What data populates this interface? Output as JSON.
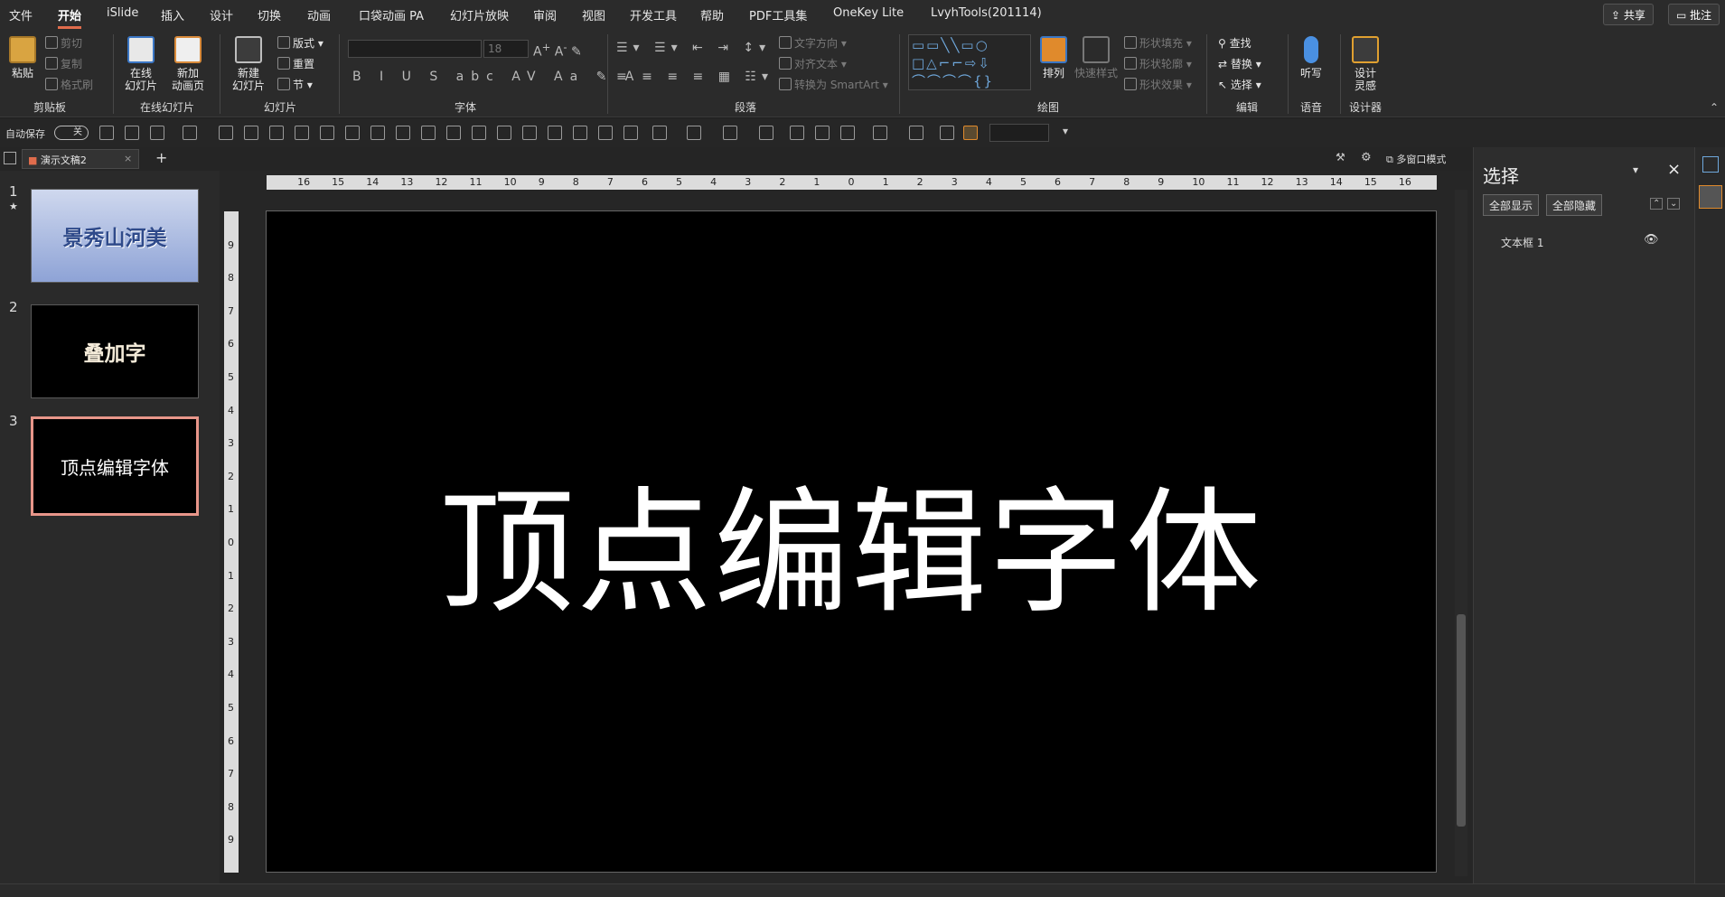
{
  "menu": {
    "items": [
      "文件",
      "开始",
      "iSlide",
      "插入",
      "设计",
      "切换",
      "动画",
      "口袋动画 PA",
      "幻灯片放映",
      "审阅",
      "视图",
      "开发工具",
      "帮助",
      "PDF工具集",
      "OneKey Lite",
      "LvyhTools(201114)"
    ],
    "active": "开始",
    "share": "共享",
    "comment": "批注"
  },
  "ribbon": {
    "clipboard": {
      "label": "剪贴板",
      "paste": "粘贴",
      "cut": "剪切",
      "copy": "复制",
      "format": "格式刷"
    },
    "online": {
      "label": "在线幻灯片",
      "online_slides": "在线\n幻灯片",
      "new_anim": "新加\n动画页"
    },
    "slides": {
      "label": "幻灯片",
      "new": "新建\n幻灯片",
      "layout": "版式",
      "reset": "重置",
      "section": "节"
    },
    "font": {
      "label": "字体",
      "size": "18"
    },
    "paragraph": {
      "label": "段落",
      "text_dir": "文字方向",
      "align_text": "对齐文本",
      "smartart": "转换为 SmartArt"
    },
    "drawing": {
      "label": "绘图",
      "arrange": "排列",
      "quick_styles": "快速样式",
      "fill": "形状填充",
      "outline": "形状轮廓",
      "effects": "形状效果"
    },
    "editing": {
      "label": "编辑",
      "find": "查找",
      "replace": "替换",
      "select": "选择"
    },
    "voice": {
      "label": "语音",
      "dictate": "听写"
    },
    "designer": {
      "label": "设计器",
      "ideas": "设计\n灵感"
    }
  },
  "qat": {
    "autosave": "自动保存",
    "toggle": "关"
  },
  "tabs": {
    "doc": "演示文稿2",
    "multiwindow": "多窗口模式"
  },
  "slides": [
    {
      "num": "1",
      "text": "景秀山河美",
      "star": "★"
    },
    {
      "num": "2",
      "text": "叠加字"
    },
    {
      "num": "3",
      "text": "顶点编辑字体"
    }
  ],
  "slide_main": {
    "text": "顶点编辑字体"
  },
  "selection_pane": {
    "title": "选择",
    "show_all": "全部显示",
    "hide_all": "全部隐藏",
    "items": [
      {
        "name": "文本框 1"
      }
    ]
  },
  "colors": {
    "accent": "#e06c4c",
    "thumb_border": "#e8968a"
  }
}
